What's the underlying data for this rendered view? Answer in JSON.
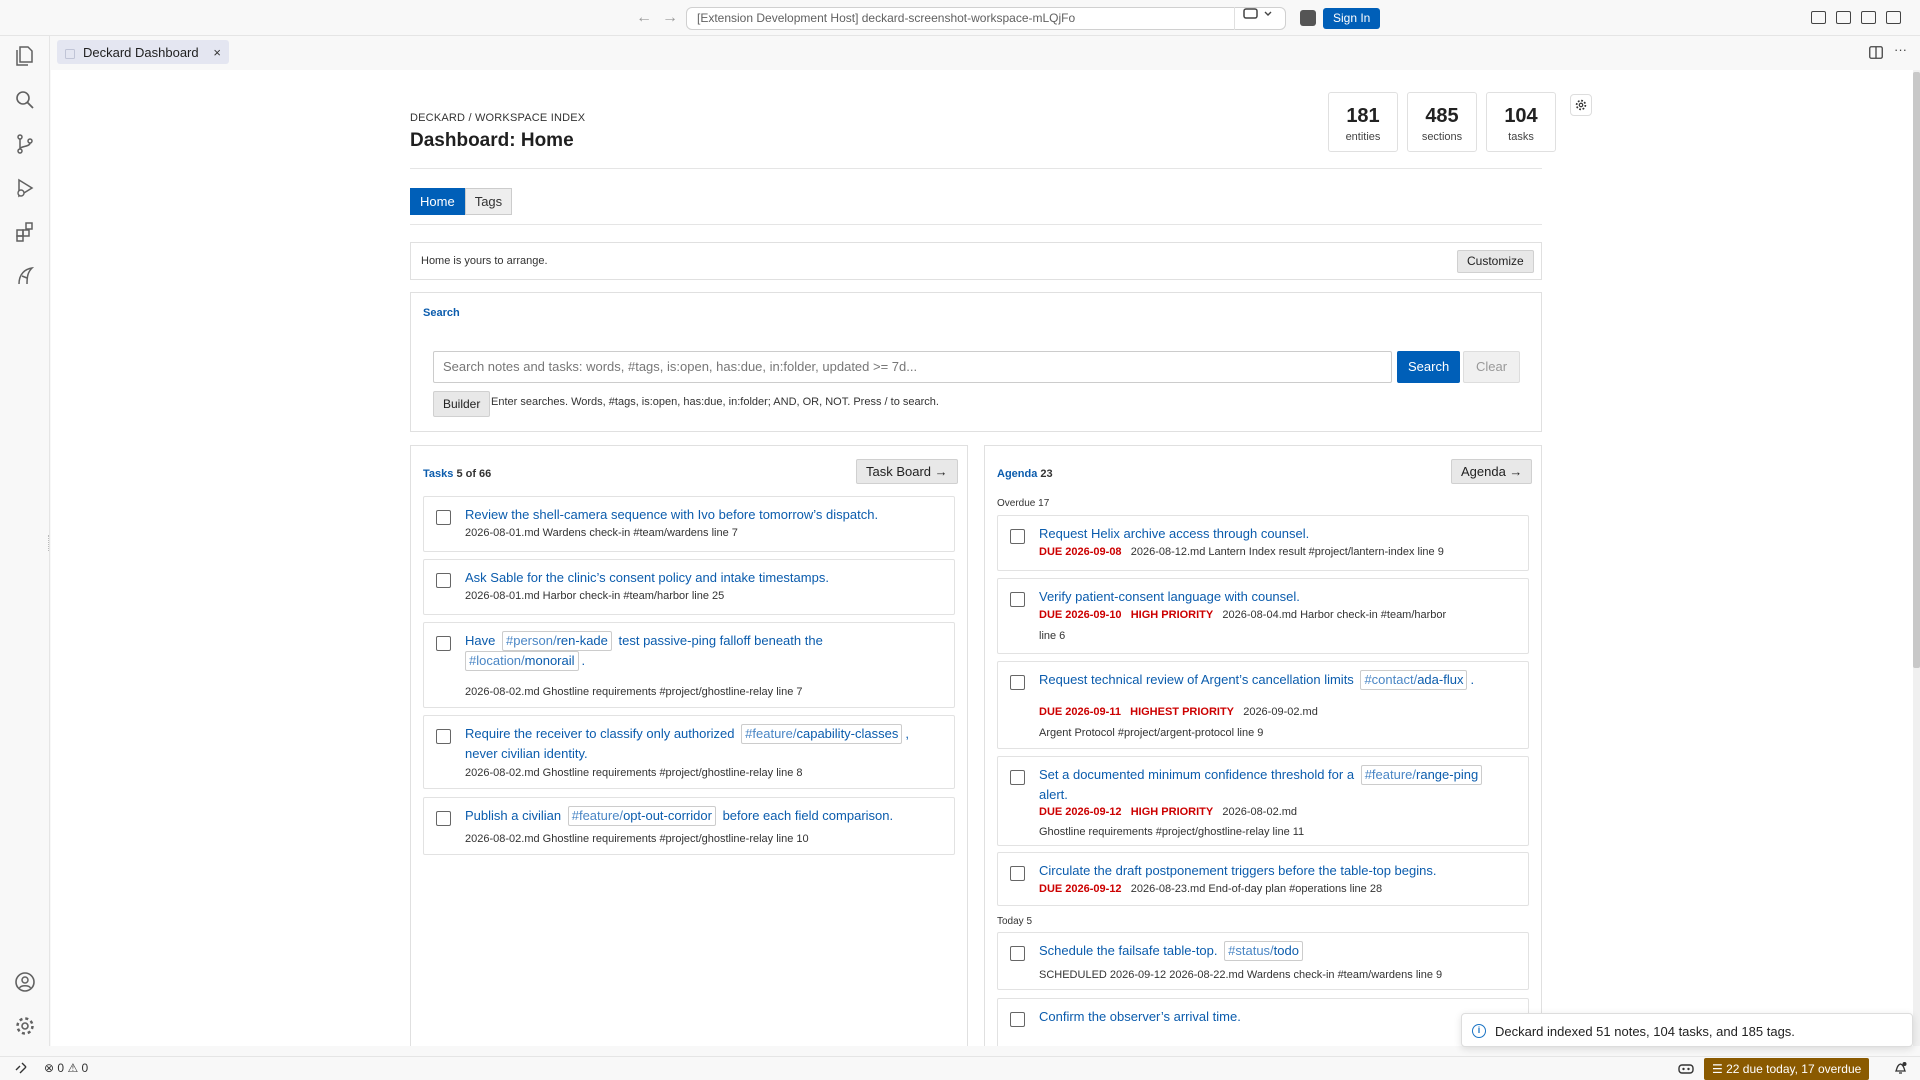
{
  "titlebar": {
    "command_center": "[Extension Development Host] deckard-screenshot-workspace-mLQjFo",
    "sign_in": "Sign In"
  },
  "editor_tab": {
    "label": "Deckard Dashboard",
    "close": "×"
  },
  "editor_more": "···",
  "header": {
    "breadcrumb": "DECKARD / WORKSPACE INDEX",
    "title": "Dashboard: Home",
    "stats": [
      {
        "value": "181",
        "label": "entities"
      },
      {
        "value": "485",
        "label": "sections"
      },
      {
        "value": "104",
        "label": "tasks"
      }
    ]
  },
  "tabs": [
    "Home",
    "Tags"
  ],
  "info": {
    "text": "Home is yours to arrange.",
    "customize": "Customize"
  },
  "search": {
    "title": "Search",
    "placeholder": "Search notes and tasks: words, #tags, is:open, has:due, in:folder, updated >= 7d...",
    "search_button": "Search",
    "clear_button": "Clear",
    "builder_button": "Builder",
    "hint": "Enter searches. Words, #tags, is:open, has:due, in:folder; AND, OR, NOT. Press / to search."
  },
  "tasks": {
    "title": "Tasks",
    "count": "5 of 66",
    "board_button": "Task Board →",
    "items": [
      {
        "text": "Review the shell-camera sequence with Ivo before tomorrow’s dispatch.",
        "meta": "2026-08-01.md   Wardens check-in #team/wardens   line 7"
      },
      {
        "text": "Ask Sable for the clinic’s consent policy and intake timestamps.",
        "meta": "2026-08-01.md   Harbor check-in #team/harbor   line 25"
      },
      {
        "text_a": "Have",
        "tag1_pre": "#person/",
        "tag1": "ren-kade",
        "text_b": "test passive-ping falloff beneath the",
        "tag2_pre": "#location/",
        "tag2": "monorail",
        "text_c": ".",
        "meta": "2026-08-02.md   Ghostline requirements #project/ghostline-relay   line 7"
      },
      {
        "text_a": "Require the receiver to classify only authorized",
        "tag_pre": "#feature/",
        "tag": "capability-classes",
        "text_b": ",",
        "text_c": "never civilian identity.",
        "meta": "2026-08-02.md   Ghostline requirements #project/ghostline-relay   line 8"
      },
      {
        "text_a": "Publish a civilian",
        "tag_pre": "#feature/",
        "tag": "opt-out-corridor",
        "text_b": "before each field comparison.",
        "meta": "2026-08-02.md   Ghostline requirements #project/ghostline-relay   line 10"
      }
    ]
  },
  "agenda": {
    "title": "Agenda",
    "count": "23",
    "button": "Agenda →",
    "overdue_label": "Overdue 17",
    "today_label": "Today 5",
    "items": [
      {
        "text": "Request Helix archive access through counsel.",
        "due": "DUE 2026-09-08",
        "meta": "2026-08-12.md   Lantern Index result #project/lantern-index   line 9"
      },
      {
        "text": "Verify patient-consent language with counsel.",
        "due": "DUE 2026-09-10",
        "priority": "HIGH PRIORITY",
        "meta": "2026-08-04.md   Harbor check-in #team/harbor",
        "meta2": "line 6"
      },
      {
        "text": "Request technical review of Argent’s cancellation limits",
        "tag_pre": "#contact/",
        "tag": "ada-flux",
        "text_b": ".",
        "due": "DUE 2026-09-11",
        "priority": "HIGHEST PRIORITY",
        "meta": "2026-09-02.md",
        "meta2": "Argent Protocol #project/argent-protocol   line 9"
      },
      {
        "text": "Set a documented minimum confidence threshold for a",
        "tag_pre": "#feature/",
        "tag": "range-ping",
        "text_c": "alert.",
        "due": "DUE 2026-09-12",
        "priority": "HIGH PRIORITY",
        "meta": "2026-08-02.md",
        "meta2": "Ghostline requirements #project/ghostline-relay   line 11"
      },
      {
        "text": "Circulate the draft postponement triggers before the table-top begins.",
        "due": "DUE 2026-09-12",
        "meta": "2026-08-23.md   End-of-day plan #operations   line 28"
      },
      {
        "text": "Schedule the failsafe table-top.",
        "tag_pre": "#status/",
        "tag": "todo",
        "meta": "SCHEDULED 2026-09-12   2026-08-22.md   Wardens check-in #team/wardens   line 9"
      },
      {
        "text": "Confirm the observer’s arrival time."
      }
    ]
  },
  "toast": {
    "message": "Deckard indexed 51 notes, 104 tasks, and 185 tags."
  },
  "statusbar": {
    "errors": "0",
    "warnings": "0",
    "due_summary": "22 due today, 17 overdue"
  }
}
